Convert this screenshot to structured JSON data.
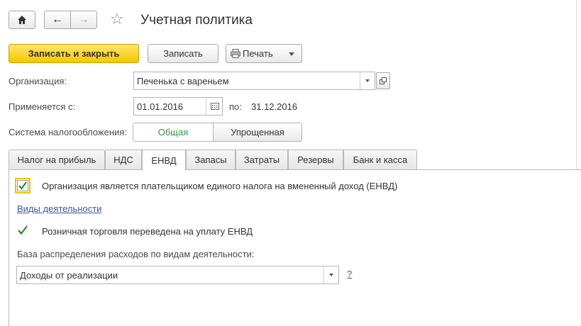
{
  "header": {
    "title": "Учетная политика"
  },
  "toolbar": {
    "save_close_label": "Записать и закрыть",
    "save_label": "Записать",
    "print_label": "Печать"
  },
  "form": {
    "organization_label": "Организация:",
    "organization_value": "Печенька с вареньем",
    "applies_label": "Применяется с:",
    "date_from": "01.01.2016",
    "to_label": "по:",
    "date_to": "31.12.2016",
    "tax_system_label": "Система налогообложения:",
    "tax_options": [
      "Общая",
      "Упрощенная"
    ],
    "tax_selected": "Общая"
  },
  "tabs": [
    {
      "label": "Налог на прибыль"
    },
    {
      "label": "НДС"
    },
    {
      "label": "ЕНВД",
      "active": true
    },
    {
      "label": "Запасы"
    },
    {
      "label": "Затраты"
    },
    {
      "label": "Резервы"
    },
    {
      "label": "Банк и касса"
    }
  ],
  "envd": {
    "payer_checkbox_label": "Организация является плательщиком единого налога на вмененный доход (ЕНВД)",
    "payer_checked": true,
    "activities_link": "Виды деятельности",
    "retail_checkbox_label": "Розничная торговля переведена на уплату ЕНВД",
    "retail_checked": true,
    "distribution_base_label": "База распределения расходов по видам деятельности:",
    "distribution_base_value": "Доходы от реализации",
    "help_link": "?"
  },
  "colors": {
    "primary_button": "#f5c800",
    "selected_option_text": "#2e9a3e",
    "link": "#3b5a9a",
    "check": "#2a8a2a"
  }
}
